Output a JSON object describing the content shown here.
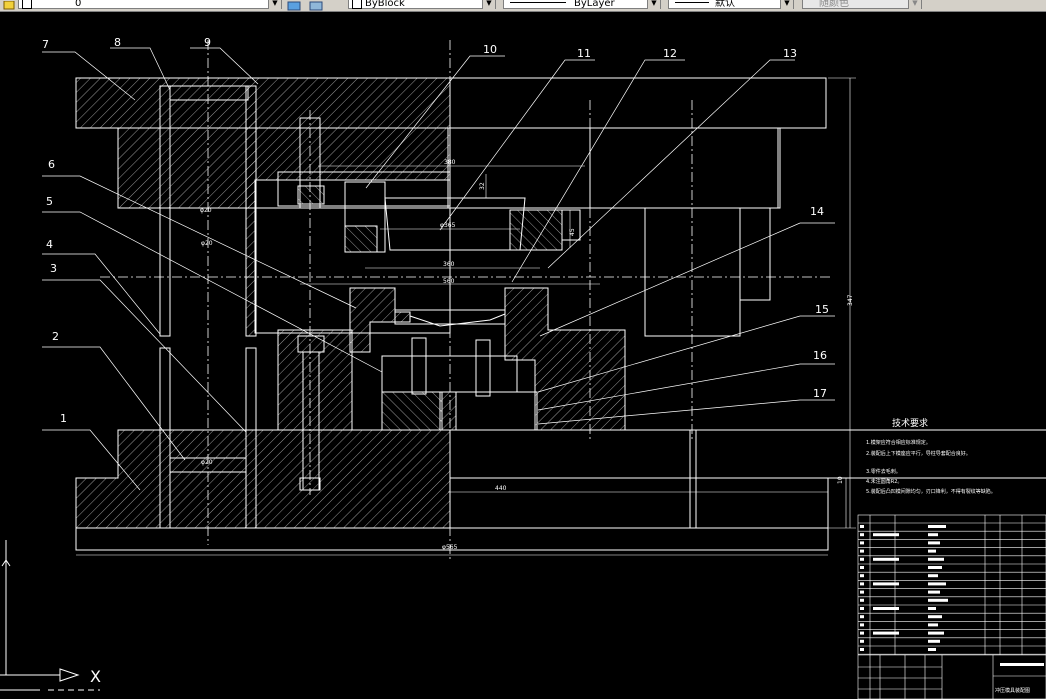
{
  "toolbar": {
    "layer_value": "0",
    "color_value": "ByBlock",
    "linetype_value": "ByLayer",
    "lineweight_value": "默认",
    "plotstyle_value": "随颜色"
  },
  "drawing": {
    "part_numbers": [
      "1",
      "2",
      "3",
      "4",
      "5",
      "6",
      "7",
      "8",
      "9",
      "10",
      "11",
      "12",
      "13",
      "14",
      "15",
      "16",
      "17"
    ],
    "dims": {
      "d380": "380",
      "d32": "32",
      "d45": "45",
      "phi365": "φ365",
      "d360": "360",
      "d560": "560",
      "d440": "440",
      "d10": "10",
      "phi565": "φ565",
      "d347": "347",
      "phi20_a": "φ20",
      "phi20_b": "φ20",
      "phi20_c": "φ20"
    },
    "tech_title": "技术要求",
    "tech_notes": [
      "1.模架应符合相应标准规定。",
      "2.装配后上下模座应平行，导柱导套配合良好。",
      "3.零件去毛刺。",
      "4.未注圆角R2。",
      "5.装配后凸凹模间隙均匀，刃口锋利，不得有裂纹等缺陷。"
    ],
    "title_block_name": "冲压模具装配图"
  },
  "ucs": {
    "x_label": "X"
  },
  "colors": {
    "background": "#000000",
    "lines": "#ffffff",
    "toolbar": "#d4d0c8"
  }
}
